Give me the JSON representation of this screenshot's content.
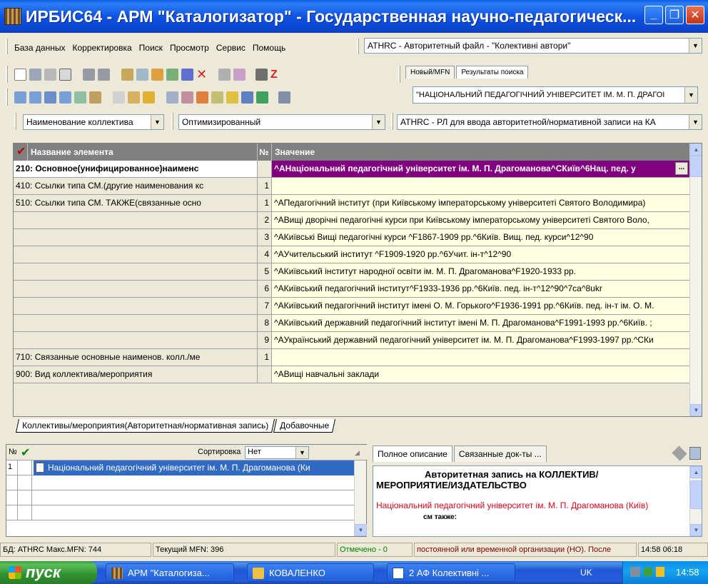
{
  "window": {
    "title": "ИРБИС64 - АРМ \"Каталогизатор\" - Государственная научно-педагогическ...",
    "min_icon": "minimize-icon",
    "max_icon": "maximize-icon",
    "close_icon": "close-icon"
  },
  "menu": {
    "items": [
      "База данных",
      "Корректировка",
      "Поиск",
      "Просмотр",
      "Сервис",
      "Помощь"
    ]
  },
  "database_select": {
    "value": "ATHRC - Авторитетный файл - \"Колективні автори\""
  },
  "right_tabs": [
    {
      "label": "Новый/MFN",
      "active": false
    },
    {
      "label": "Результаты поиска",
      "active": true
    }
  ],
  "search_result": {
    "value": "\"НАЦІОНАЛЬНИЙ ПЕДАГОГІЧНИЙ УНІВЕРСИТЕТ ІМ. М. П. ДРАГОІ"
  },
  "filters": {
    "name_type": "Наименование коллектива",
    "mode": "Оптимизированный",
    "worksheet": "ATHRC - РЛ для ввода авторитетной/нормативной записи на КА"
  },
  "grid": {
    "headers": {
      "name": "Название элемента",
      "num": "№",
      "value": "Значение"
    },
    "rows": [
      {
        "name": "210: Основное(унифицированное)наименс",
        "num": "",
        "value": "^AНаціональний педагогічний університет ім. М. П. Драгоманова^CКиїв^6Нац. пед. у"
      },
      {
        "name": "410: Ссылки типа СМ.(другие наименования кс",
        "num": "1",
        "value": ""
      },
      {
        "name": "510: Ссылки типа СМ. ТАКЖЕ(связанные осно",
        "num": "1",
        "value": "^AПедагогічний інститут (при Київському імператорському університеті Святого Володимира)"
      },
      {
        "name": "",
        "num": "2",
        "value": "^AВищі дворічні педагогічні курси при Київському імператорському університеті Святого Воло,"
      },
      {
        "name": "",
        "num": "3",
        "value": "^AКиївські Вищі педагогічні курси ^F1867-1909 рр.^6Київ. Вищ. пед. курси^12^90"
      },
      {
        "name": "",
        "num": "4",
        "value": "^AУчительський інститут ^F1909-1920 рр.^6Учит. ін-т^12^90"
      },
      {
        "name": "",
        "num": "5",
        "value": "^AКиївський інститут народної освіти ім. М. П. Драгоманова^F1920-1933 рр."
      },
      {
        "name": "",
        "num": "6",
        "value": "^AКиївський педагогічний інститут^F1933-1936 рр.^6Київ. пед. ін-т^12^90^7ca^8ukr"
      },
      {
        "name": "",
        "num": "7",
        "value": "^AКиївський педагогічний інститут імені О. М. Горького^F1936-1991 рр.^6Київ. пед. ін-т ім. О. М."
      },
      {
        "name": "",
        "num": "8",
        "value": "^AКиївський державний педагогічний інститут імені М. П. Драгоманова^F1991-1993 рр.^6Київ. ;"
      },
      {
        "name": "",
        "num": "9",
        "value": "^AУкраїнський державний педагогічний університет ім. М. П. Драгоманова^F1993-1997 рр.^CКи"
      },
      {
        "name": "710: Связанные основные наименов. колл./ме",
        "num": "1",
        "value": ""
      },
      {
        "name": "900: Вид коллектива/мероприятия",
        "num": "",
        "value": "^AВищі навчальні заклади"
      }
    ]
  },
  "sub_tabs": [
    "Коллективы/мероприятия(Авторитетная/нормативная запись)",
    "Добавочные"
  ],
  "list": {
    "num_header": "№",
    "sort_label": "Сортировка",
    "sort_value": "Нет",
    "rows": [
      {
        "num": "1",
        "text": "Національний педагогічний університет ім. М. П. Драгоманова (Ки"
      }
    ]
  },
  "desc_tabs": [
    {
      "label": "Полное описание",
      "active": true
    },
    {
      "label": "Связанные док-ты ...",
      "active": false
    }
  ],
  "description": {
    "heading_line1": "Авторитетная запись на КОЛЛЕКТИВ/",
    "heading_line2": "МЕРОПРИЯТИЕ/ИЗДАТЕЛЬСТВО",
    "red_text": "Національний педагогічний університет ім. М. П. Драгоманова (Київ)",
    "cut_text": "см также:"
  },
  "status": {
    "db": "БД: ATHRC Макс.MFN: 744",
    "current": "Текущий MFN: 396",
    "marked": "Отмечено - 0",
    "hint": "постоянной или временной организации (НО). После",
    "time": "14:58 06:18"
  },
  "taskbar": {
    "start": "пуск",
    "tasks": [
      "АРМ \"Каталогиза...",
      "КОВАЛЕНКО",
      "2 АФ Колективні ..."
    ],
    "lang": "UK",
    "clock": "14:58"
  },
  "colors": {
    "selected_field": "#800080",
    "value_cell": "#ffffe1",
    "red_text": "#e0001a",
    "marked": "#008000",
    "hint": "#800000"
  }
}
